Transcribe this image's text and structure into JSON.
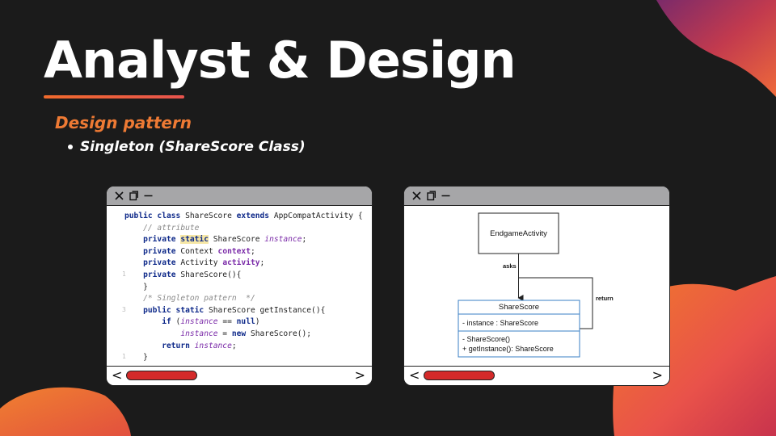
{
  "slide": {
    "title": "Analyst & Design",
    "subtitle": "Design pattern",
    "bullet": "Singleton (ShareScore Class)"
  },
  "colors": {
    "background": "#1b1b1b",
    "accent_orange": "#ee7a34",
    "accent_red": "#e8544e",
    "titlebar_gray": "#a6a6a8",
    "scroll_thumb_red": "#d42a2a",
    "uml_blue": "#3a7fc4"
  },
  "left_window": {
    "titlebar_icons": [
      "close-icon",
      "copy-icon",
      "minimize-icon"
    ],
    "nav": {
      "left_arrow": "<",
      "right_arrow": ">"
    },
    "gutter_marks": {
      "line5": "1",
      "line8": "3",
      "line12": "1"
    },
    "code": {
      "l1_kw": "public class ",
      "l1_rest": "ShareScore ",
      "l1_kw2": "extends ",
      "l1_end": "AppCompatActivity {",
      "l2": "// attribute",
      "l3_kw": "private ",
      "l3_static": "static",
      "l3_type": " ShareScore ",
      "l3_field": "instance",
      "l3_end": ";",
      "l4_kw": "private ",
      "l4_type": "Context ",
      "l4_field": "context",
      "l4_end": ";",
      "l5_kw": "private ",
      "l5_type": "Activity ",
      "l5_field": "activity",
      "l5_end": ";",
      "l6_kw": "private ",
      "l6_rest": "ShareScore(){",
      "l7": "}",
      "l8": "/* Singleton pattern  */",
      "l9_kw": "public static ",
      "l9_rest": "ShareScore getInstance(){",
      "l10_kw": "if ",
      "l10_open": "(",
      "l10_field": "instance",
      "l10_eq": " == ",
      "l10_null": "null",
      "l10_close": ")",
      "l11_field": "instance",
      "l11_eq": " = ",
      "l11_new": "new ",
      "l11_rest": "ShareScore();",
      "l12_kw": "return ",
      "l12_field": "instance",
      "l12_end": ";",
      "l13": "}"
    }
  },
  "right_window": {
    "titlebar_icons": [
      "close-icon",
      "copy-icon",
      "minimize-icon"
    ],
    "nav": {
      "left_arrow": "<",
      "right_arrow": ">"
    },
    "uml": {
      "actor_box": "EndgameActivity",
      "edge_asks": "asks",
      "edge_return": "return",
      "class_name": "ShareScore",
      "attribute": "- instance : ShareScore",
      "method1": "-  ShareScore()",
      "method2": "+ getInstance(): ShareScore"
    }
  }
}
